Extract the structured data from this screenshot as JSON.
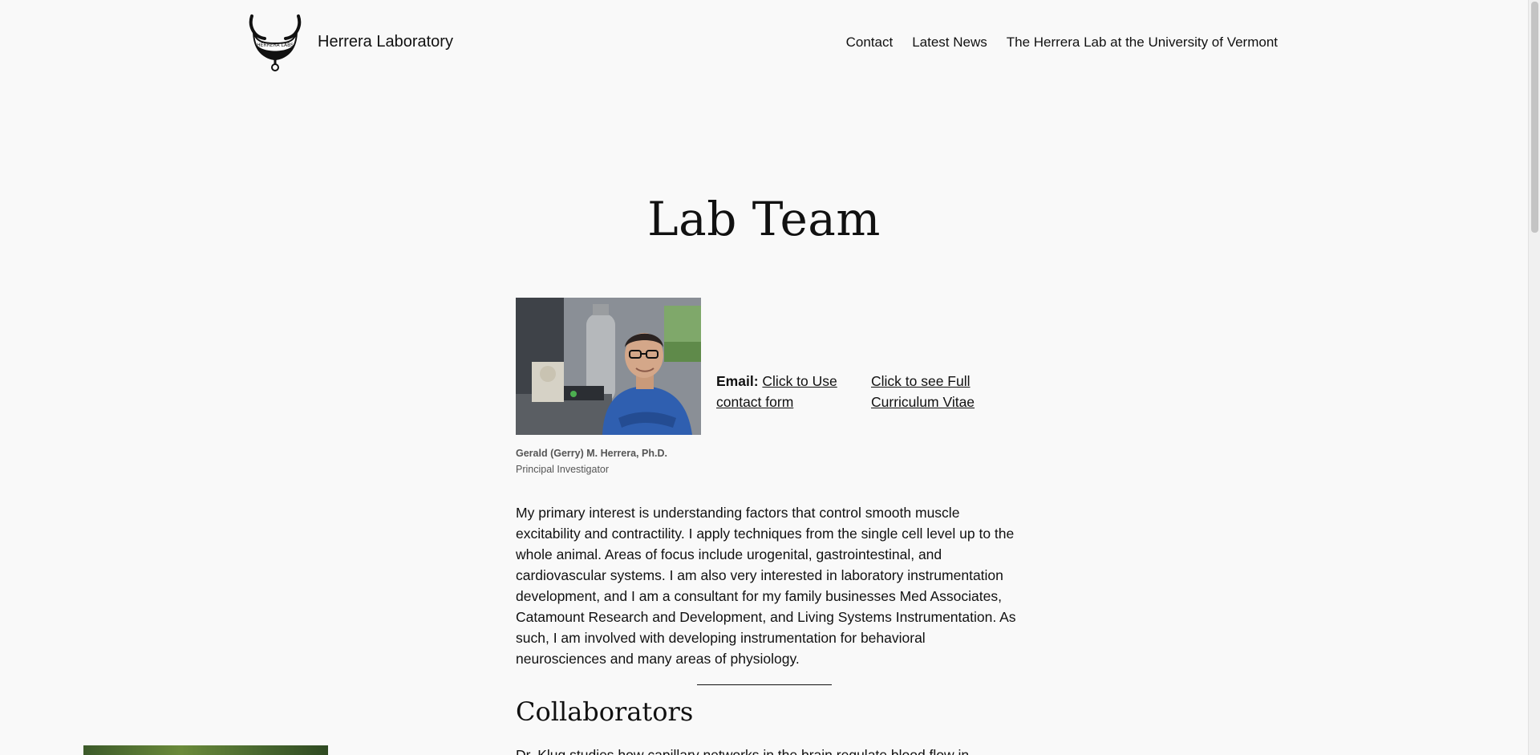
{
  "header": {
    "site_title": "Herrera Laboratory",
    "logo_text": "HERRERA LABS",
    "nav": [
      {
        "label": "Contact"
      },
      {
        "label": "Latest News"
      },
      {
        "label": "The Herrera Lab at the University of Vermont"
      }
    ]
  },
  "main": {
    "title": "Lab Team",
    "profile": {
      "name": "Gerald (Gerry) M. Herrera, Ph.D.",
      "role": "Principal Investigator",
      "email_label": "Email:",
      "email_link": "Click to Use contact form",
      "cv_link": "Click to see Full Curriculum Vitae",
      "bio": "My primary interest is understanding factors that control smooth muscle excitability and contractility.  I apply techniques from the single cell level up to the whole animal.  Areas of focus include urogenital, gastrointestinal, and cardiovascular systems.  I am also very interested in laboratory instrumentation development, and I am a consultant for my family businesses Med Associates, Catamount Research and Development, and Living Systems Instrumentation.  As such, I am involved with developing instrumentation for behavioral neurosciences and many areas of physiology."
    },
    "collaborators": {
      "heading": "Collaborators",
      "intro": "Dr. Klug studies how capillary networks in the brain regulate blood flow in"
    }
  },
  "colors": {
    "background": "#f9f9f9",
    "text": "#111111",
    "shirt_blue": "#2f5fb0"
  },
  "icons": {
    "logo": "bladder-logo-icon"
  }
}
